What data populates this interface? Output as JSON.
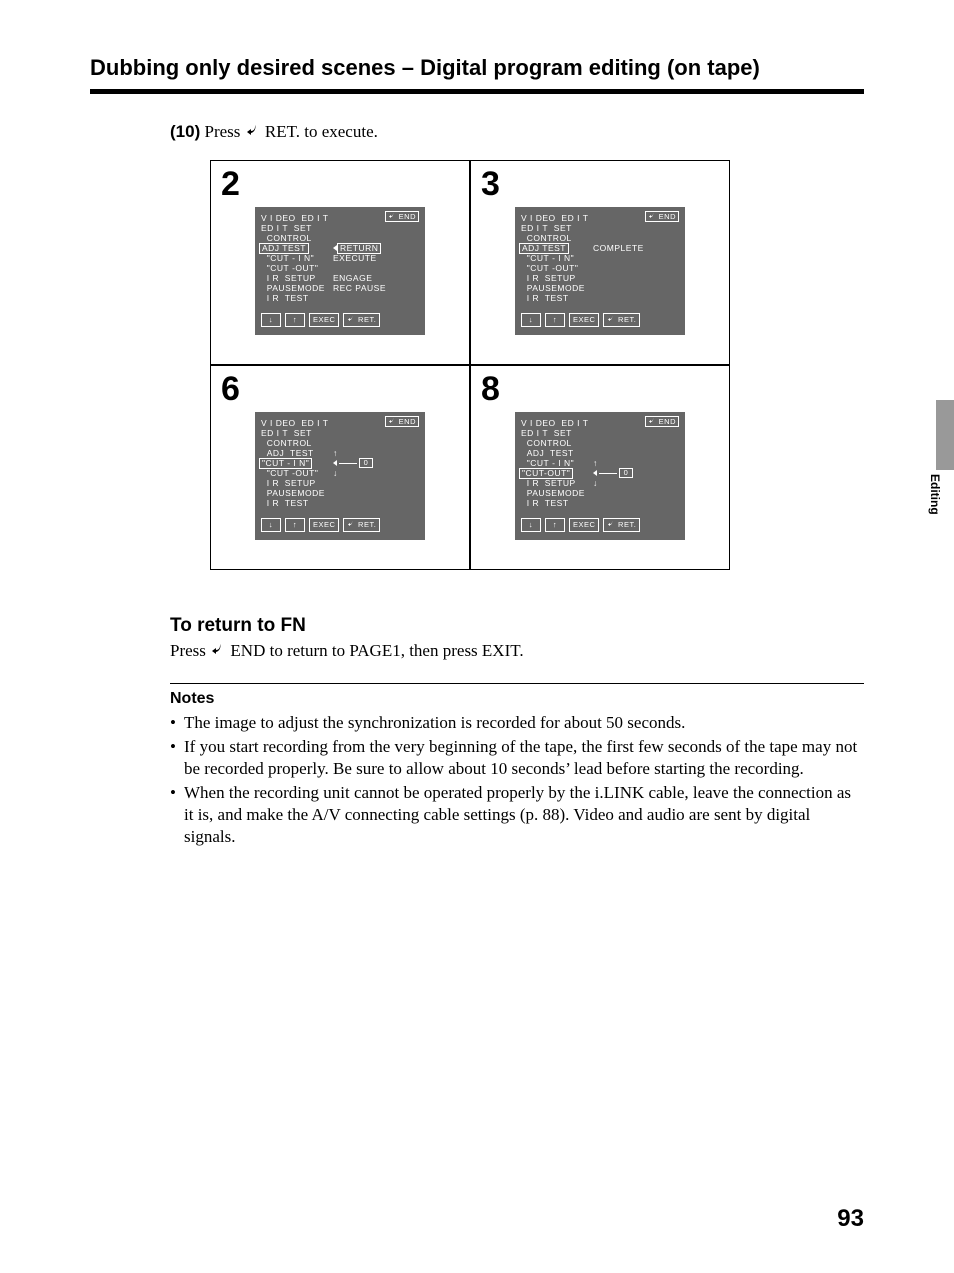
{
  "title": "Dubbing only desired scenes – Digital program editing (on tape)",
  "step10": {
    "num": "(10)",
    "pre": "Press ",
    "post": " RET. to execute."
  },
  "return_icon": "↩",
  "panels": [
    {
      "num": "2",
      "end": "END",
      "rows": [
        {
          "l": "V I DEO  ED I T",
          "r": ""
        },
        {
          "l": "ED I T  SET",
          "r": ""
        },
        {
          "l": "  CONTROL",
          "r": ""
        },
        {
          "l": "ADJ  TEST",
          "boxL": true,
          "r": "RETURN",
          "tri": true,
          "boxR": true
        },
        {
          "l": "  \"CUT - I N\"",
          "r": "EXECUTE"
        },
        {
          "l": "  \"CUT -OUT\"",
          "r": ""
        },
        {
          "l": "  I R  SETUP",
          "r": "ENGAGE"
        },
        {
          "l": "  PAUSEMODE",
          "r": "REC  PAUSE"
        },
        {
          "l": "  I R  TEST",
          "r": ""
        }
      ],
      "footer": [
        "↓",
        "↑",
        "EXEC",
        "RET."
      ]
    },
    {
      "num": "3",
      "end": "END",
      "rows": [
        {
          "l": "V I DEO  ED I T",
          "r": ""
        },
        {
          "l": "ED I T  SET",
          "r": ""
        },
        {
          "l": "  CONTROL",
          "r": ""
        },
        {
          "l": "ADJ  TEST",
          "boxL": true,
          "r": "COMPLETE"
        },
        {
          "l": "  \"CUT - I N\"",
          "r": ""
        },
        {
          "l": "  \"CUT -OUT\"",
          "r": ""
        },
        {
          "l": "  I R  SETUP",
          "r": ""
        },
        {
          "l": "  PAUSEMODE",
          "r": ""
        },
        {
          "l": "  I R  TEST",
          "r": ""
        }
      ],
      "footer": [
        "↓",
        "↑",
        "EXEC",
        "RET."
      ]
    },
    {
      "num": "6",
      "end": "END",
      "rows": [
        {
          "l": "V I DEO  ED I T",
          "r": ""
        },
        {
          "l": "ED I T  SET",
          "r": ""
        },
        {
          "l": "  CONTROL",
          "r": ""
        },
        {
          "l": "  ADJ  TEST",
          "r": "↑",
          "arrowUp": true
        },
        {
          "l": "\"CUT - I N\"",
          "boxL": true,
          "slider": "0"
        },
        {
          "l": "  \"CUT -OUT\"",
          "r": "↓",
          "arrowDown": true
        },
        {
          "l": "  I R  SETUP",
          "r": ""
        },
        {
          "l": "  PAUSEMODE",
          "r": ""
        },
        {
          "l": "  I R  TEST",
          "r": ""
        }
      ],
      "footer": [
        "↓",
        "↑",
        "EXEC",
        "RET."
      ]
    },
    {
      "num": "8",
      "end": "END",
      "rows": [
        {
          "l": "V I DEO  ED I T",
          "r": ""
        },
        {
          "l": "ED I T  SET",
          "r": ""
        },
        {
          "l": "  CONTROL",
          "r": ""
        },
        {
          "l": "  ADJ  TEST",
          "r": ""
        },
        {
          "l": "  \"CUT - I N\"",
          "r": "↑",
          "arrowUp": true
        },
        {
          "l": "\"CUT-OUT\"",
          "boxL": true,
          "slider": "0"
        },
        {
          "l": "  I R  SETUP",
          "r": "↓",
          "arrowDown": true
        },
        {
          "l": "  PAUSEMODE",
          "r": ""
        },
        {
          "l": "  I R  TEST",
          "r": ""
        }
      ],
      "footer": [
        "↓",
        "↑",
        "EXEC",
        "RET."
      ]
    }
  ],
  "return_fn": {
    "heading": "To return to FN",
    "pre": "Press ",
    "post": " END to return to PAGE1, then press EXIT."
  },
  "notes_heading": "Notes",
  "notes": [
    "The image to adjust the synchronization is recorded for about 50 seconds.",
    "If you start recording from the very beginning of the tape, the first few seconds of the tape may not be recorded properly. Be sure to allow about 10 seconds’ lead before starting the recording.",
    "When the recording unit cannot be operated properly by the i.LINK cable, leave the connection as it is, and make the A/V connecting cable settings (p. 88). Video and audio are sent by digital signals."
  ],
  "side_label": "Editing",
  "page_number": "93"
}
